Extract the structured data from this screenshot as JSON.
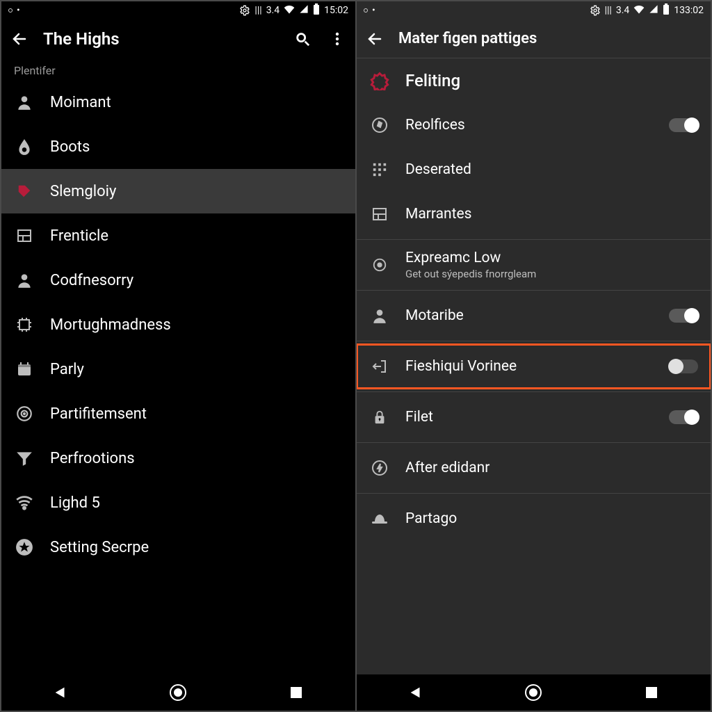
{
  "left": {
    "status": {
      "net": "3.4",
      "time": "15:02"
    },
    "title": "The Highs",
    "section_label": "Plentifer",
    "items": [
      {
        "label": "Moimant",
        "icon": "person"
      },
      {
        "label": "Boots",
        "icon": "drop"
      },
      {
        "label": "Slemgloiy",
        "icon": "tag",
        "selected": true
      },
      {
        "label": "Frenticle",
        "icon": "panel"
      },
      {
        "label": "Codfnesorry",
        "icon": "person"
      },
      {
        "label": "Mortughmadness",
        "icon": "chip"
      },
      {
        "label": "Parly",
        "icon": "calendar"
      },
      {
        "label": "Partifitemsent",
        "icon": "target"
      },
      {
        "label": "Perfrootions",
        "icon": "funnel"
      },
      {
        "label": "Lighd 5",
        "icon": "wifi"
      },
      {
        "label": "Setting Secrpe",
        "icon": "star"
      }
    ]
  },
  "right": {
    "status": {
      "net": "3.4",
      "time": "133:02"
    },
    "title": "Mater figen pattiges",
    "header": {
      "label": "Feliting",
      "icon": "ring",
      "accent": "#b71c3a"
    },
    "items": [
      {
        "label": "Reolfices",
        "icon": "compass",
        "toggle": "on"
      },
      {
        "label": "Deserated",
        "icon": "grid"
      },
      {
        "label": "Marrantes",
        "icon": "panel"
      },
      {
        "divider": true
      },
      {
        "label": "Expreamc Low",
        "sub": "Get out sýepedis fnorrgleam",
        "icon": "radio"
      },
      {
        "divider": true
      },
      {
        "label": "Motaribe",
        "icon": "person",
        "toggle": "on"
      },
      {
        "divider": true
      },
      {
        "label": "Fieshiqui Vorinee",
        "icon": "exit",
        "toggle": "off",
        "highlighted": true
      },
      {
        "divider": true
      },
      {
        "label": "Filet",
        "icon": "lock",
        "toggle": "on"
      },
      {
        "divider": true
      },
      {
        "label": "After edidanr",
        "icon": "bolt"
      },
      {
        "divider": true
      },
      {
        "label": "Partago",
        "icon": "hat"
      }
    ]
  }
}
